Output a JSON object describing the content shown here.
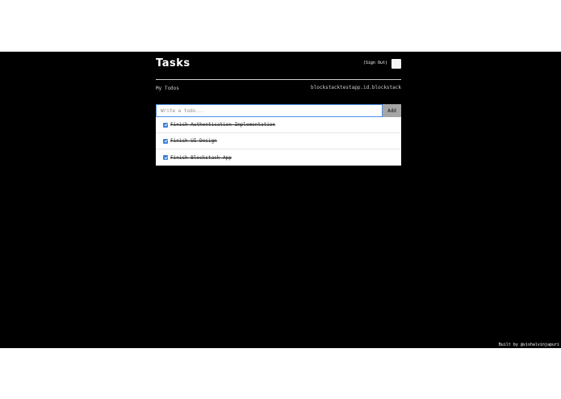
{
  "header": {
    "title": "Tasks",
    "sign_out_label": "(Sign Out)"
  },
  "subheader": {
    "section_label": "My Todos",
    "user_id": "blockstacktestapp.id.blockstack"
  },
  "form": {
    "input_placeholder": "Write a todo...",
    "input_value": "",
    "add_label": "Add"
  },
  "todos": [
    {
      "text": "Finish Authentication Implementation",
      "completed": true
    },
    {
      "text": "Finish UI Design",
      "completed": true
    },
    {
      "text": "Finish Blockstack App",
      "completed": true
    }
  ],
  "footer": {
    "credit": "Built by @vishalvinjapuri"
  },
  "colors": {
    "background": "#000000",
    "checkbox": "#3b82d9",
    "input_border": "#4a90e2",
    "add_button": "#a6a6a6"
  },
  "icons": {
    "avatar": "avatar",
    "checkbox": "checkmark-icon"
  }
}
